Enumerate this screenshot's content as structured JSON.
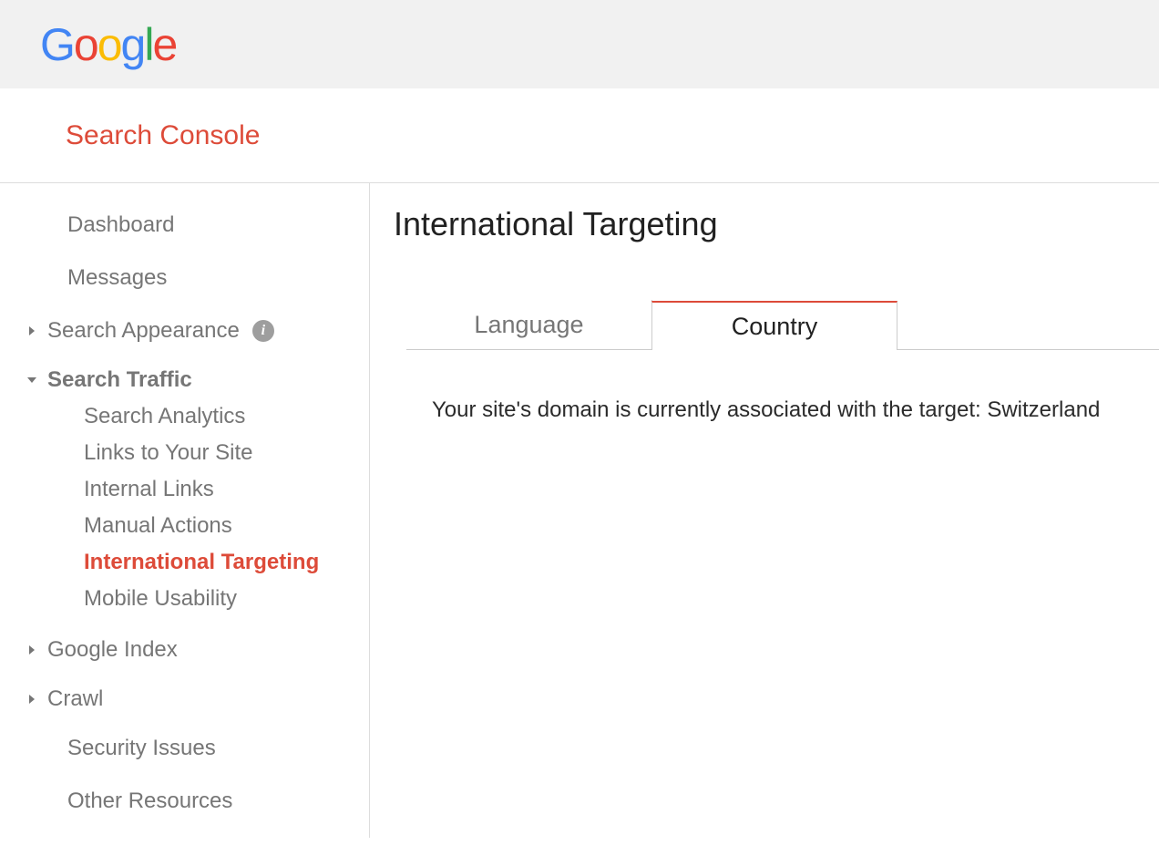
{
  "logo": {
    "text": "Google"
  },
  "app_title": "Search Console",
  "sidebar": {
    "dashboard": "Dashboard",
    "messages": "Messages",
    "search_appearance": "Search Appearance",
    "search_traffic": {
      "label": "Search Traffic",
      "items": [
        "Search Analytics",
        "Links to Your Site",
        "Internal Links",
        "Manual Actions",
        "International Targeting",
        "Mobile Usability"
      ],
      "active_index": 4
    },
    "google_index": "Google Index",
    "crawl": "Crawl",
    "security_issues": "Security Issues",
    "other_resources": "Other Resources"
  },
  "page": {
    "title": "International Targeting",
    "tabs": {
      "language": "Language",
      "country": "Country"
    },
    "body_text": "Your site's domain is currently associated with the target: Switzerland"
  }
}
